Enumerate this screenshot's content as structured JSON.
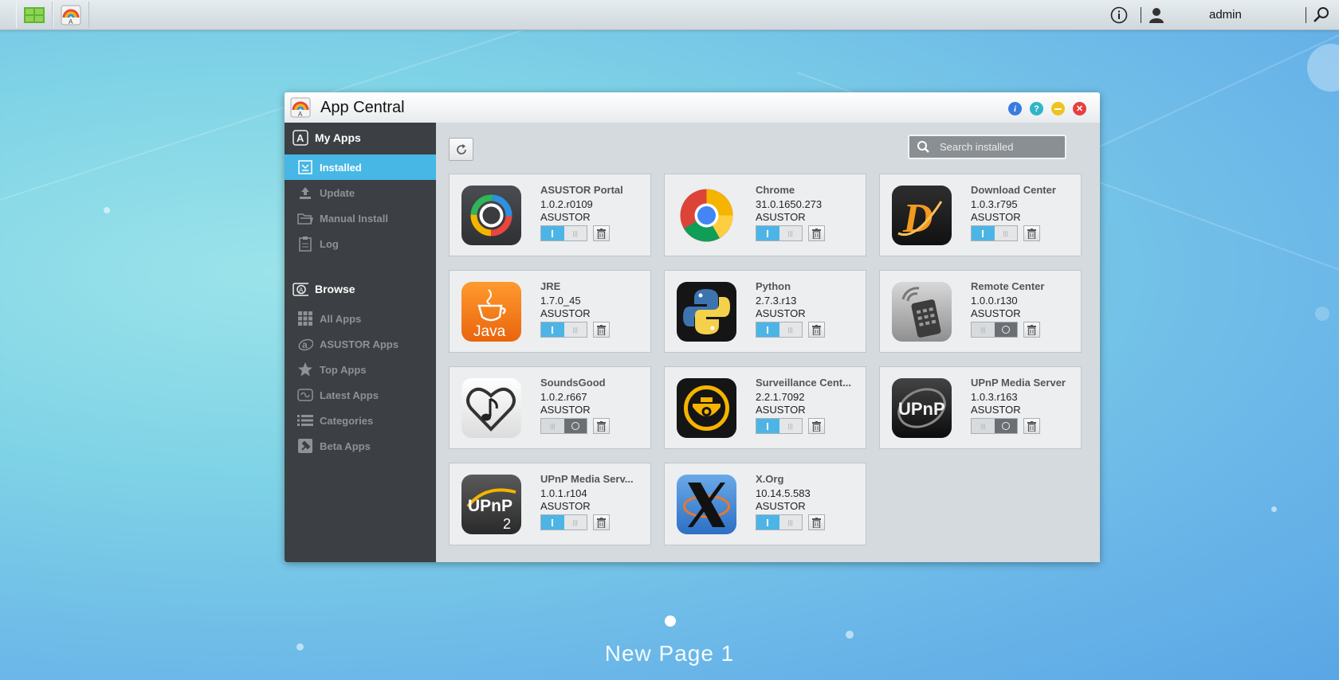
{
  "topbar": {
    "apps": [
      {
        "icon": "grid-desktop-icon"
      },
      {
        "icon": "app-central-icon"
      }
    ],
    "user": "admin"
  },
  "window": {
    "title": "App Central"
  },
  "sidebar": {
    "my_apps": {
      "label": "My Apps",
      "items": [
        {
          "label": "Installed",
          "active": true,
          "icon": "installed-icon"
        },
        {
          "label": "Update",
          "icon": "update-icon"
        },
        {
          "label": "Manual Install",
          "icon": "folder-icon"
        },
        {
          "label": "Log",
          "icon": "log-icon"
        }
      ]
    },
    "browse": {
      "label": "Browse",
      "items": [
        {
          "label": "All Apps",
          "icon": "grid-icon"
        },
        {
          "label": "ASUSTOR Apps",
          "icon": "asustor-icon"
        },
        {
          "label": "Top Apps",
          "icon": "star-icon"
        },
        {
          "label": "Latest Apps",
          "icon": "latest-icon"
        },
        {
          "label": "Categories",
          "icon": "list-icon"
        },
        {
          "label": "Beta Apps",
          "icon": "hammer-icon"
        }
      ]
    }
  },
  "search": {
    "placeholder": "Search installed"
  },
  "apps": [
    {
      "name": "ASUSTOR Portal",
      "version": "1.0.2.r0109",
      "vendor": "ASUSTOR",
      "enabled": true
    },
    {
      "name": "Chrome",
      "version": "31.0.1650.273",
      "vendor": "ASUSTOR",
      "enabled": true
    },
    {
      "name": "Download Center",
      "version": "1.0.3.r795",
      "vendor": "ASUSTOR",
      "enabled": true
    },
    {
      "name": "JRE",
      "version": "1.7.0_45",
      "vendor": "ASUSTOR",
      "enabled": true
    },
    {
      "name": "Python",
      "version": "2.7.3.r13",
      "vendor": "ASUSTOR",
      "enabled": true
    },
    {
      "name": "Remote Center",
      "version": "1.0.0.r130",
      "vendor": "ASUSTOR",
      "enabled": false
    },
    {
      "name": "SoundsGood",
      "version": "1.0.2.r667",
      "vendor": "ASUSTOR",
      "enabled": false
    },
    {
      "name": "Surveillance Cent...",
      "version": "2.2.1.7092",
      "vendor": "ASUSTOR",
      "enabled": true
    },
    {
      "name": "UPnP Media Server",
      "version": "1.0.3.r163",
      "vendor": "ASUSTOR",
      "enabled": false
    },
    {
      "name": "UPnP Media Serv...",
      "version": "1.0.1.r104",
      "vendor": "ASUSTOR",
      "enabled": true
    },
    {
      "name": "X.Org",
      "version": "10.14.5.583",
      "vendor": "ASUSTOR",
      "enabled": true
    }
  ],
  "desktop": {
    "page_label": "New Page 1"
  },
  "colors": {
    "accent": "#47b7e5",
    "sidebar": "#3c3f43"
  }
}
